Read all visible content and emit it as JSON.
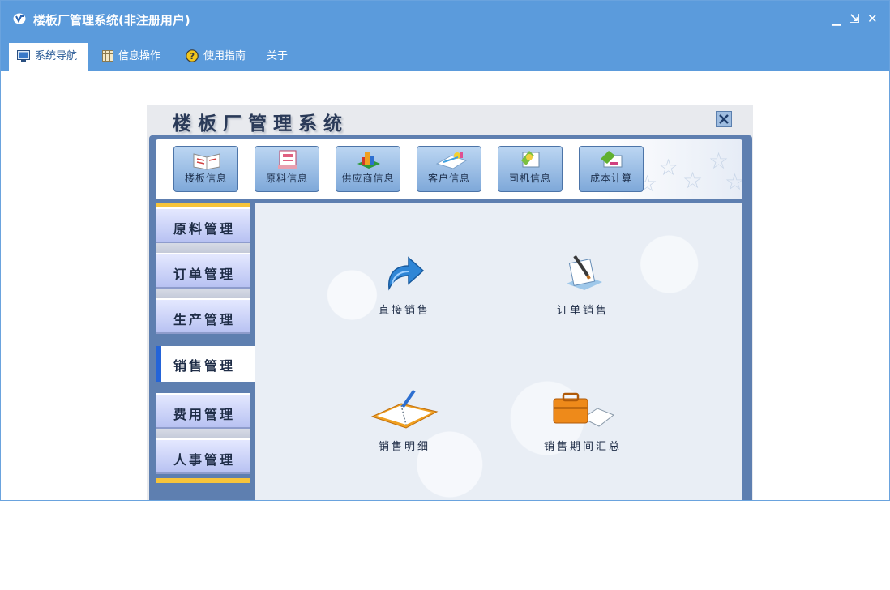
{
  "window": {
    "title": "楼板厂管理系统(非注册用户)",
    "controls": {
      "minimize": "▁",
      "restore": "⇲",
      "close": "✕"
    }
  },
  "menu": {
    "tabs": [
      {
        "label": "系统导航",
        "icon": "monitor-icon",
        "active": true
      },
      {
        "label": "信息操作",
        "icon": "grid-icon",
        "active": false
      },
      {
        "label": "使用指南",
        "icon": "help-icon",
        "active": false
      },
      {
        "label": "关于",
        "icon": "",
        "active": false
      }
    ]
  },
  "inner": {
    "title": "楼板厂管理系统",
    "close_icon": "close-icon",
    "toolbar": [
      {
        "label": "楼板信息",
        "icon": "book-icon"
      },
      {
        "label": "原料信息",
        "icon": "material-icon"
      },
      {
        "label": "供应商信息",
        "icon": "supplier-icon"
      },
      {
        "label": "客户信息",
        "icon": "customer-icon"
      },
      {
        "label": "司机信息",
        "icon": "driver-icon"
      },
      {
        "label": "成本计算",
        "icon": "cost-icon"
      }
    ],
    "sidebar": [
      {
        "label": "原料管理",
        "active": false
      },
      {
        "label": "订单管理",
        "active": false
      },
      {
        "label": "生产管理",
        "active": false
      },
      {
        "label": "销售管理",
        "active": true
      },
      {
        "label": "费用管理",
        "active": false
      },
      {
        "label": "人事管理",
        "active": false
      }
    ],
    "functions": [
      {
        "label": "直接销售",
        "icon": "arrow-icon"
      },
      {
        "label": "订单销售",
        "icon": "order-icon"
      },
      {
        "label": "销售明细",
        "icon": "notebook-icon"
      },
      {
        "label": "销售期间汇总",
        "icon": "briefcase-icon"
      }
    ]
  },
  "colors": {
    "titlebar": "#5b9bdc",
    "active_tab_text": "#2c5d98",
    "sidebar_active_marker": "#2464d8"
  }
}
